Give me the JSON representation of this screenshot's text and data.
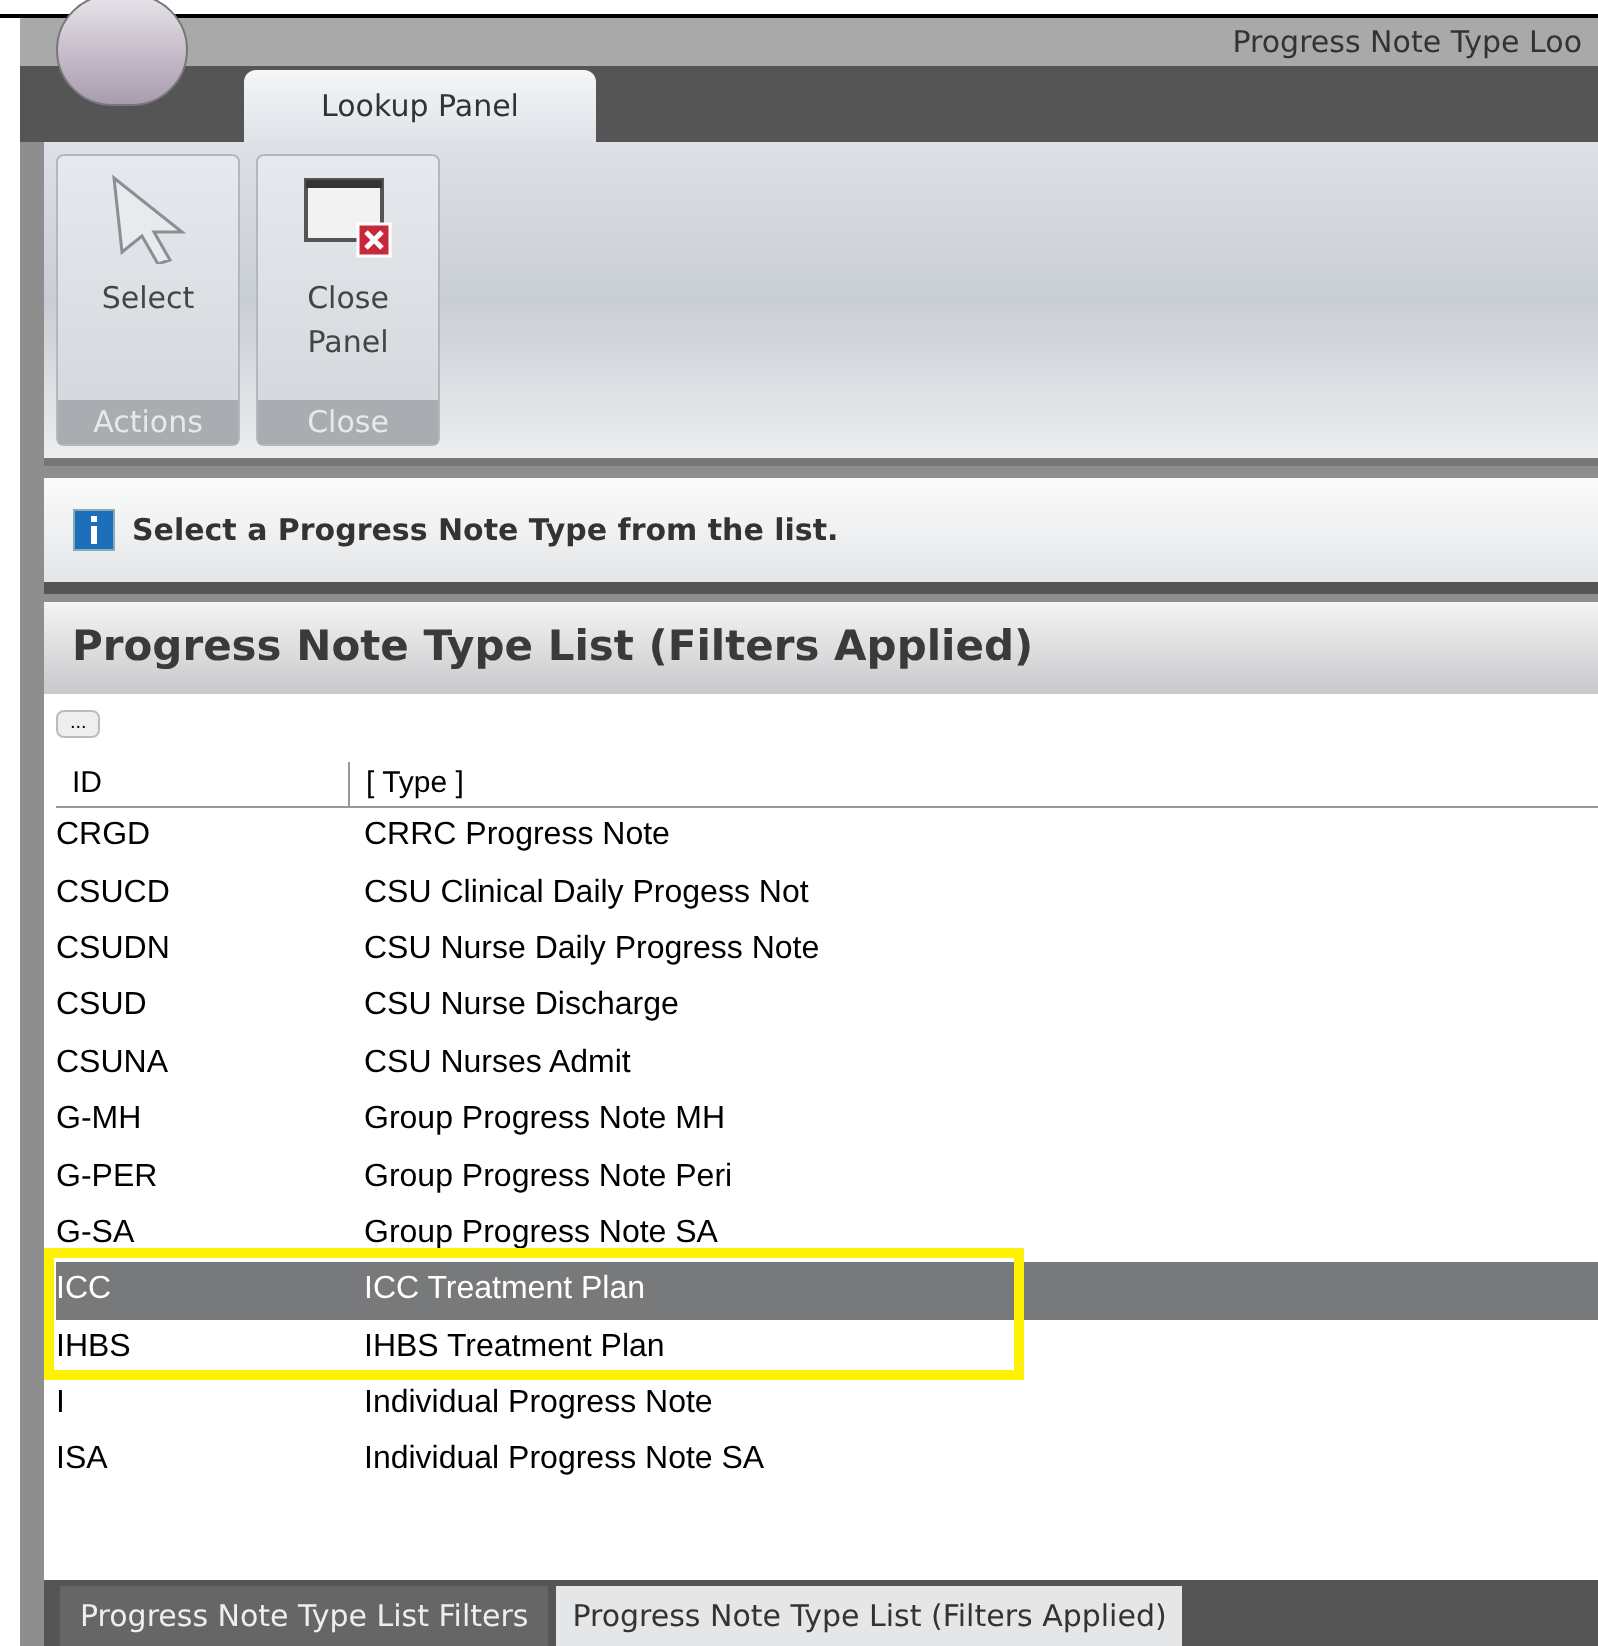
{
  "window": {
    "title": "Progress Note Type Loo"
  },
  "ribbon": {
    "tabs": [
      {
        "label": "Lookup Panel",
        "selected": true
      }
    ],
    "groups": [
      {
        "label": "Actions",
        "buttons": [
          {
            "label": "Select",
            "kind": "pointer"
          }
        ]
      },
      {
        "label": "Close",
        "buttons": [
          {
            "label": "Close Panel",
            "kind": "close"
          }
        ]
      }
    ]
  },
  "info": {
    "message": "Select a Progress Note Type from the list."
  },
  "list": {
    "title": "Progress Note Type List (Filters Applied)",
    "menu_button": "...",
    "columns": [
      "ID",
      "[ Type ]"
    ],
    "rows": [
      {
        "id": "CRGD",
        "type": "CRRC Progress Note",
        "selected": false
      },
      {
        "id": "CSUCD",
        "type": "CSU Clinical Daily Progess Not",
        "selected": false
      },
      {
        "id": "CSUDN",
        "type": "CSU Nurse Daily Progress Note",
        "selected": false
      },
      {
        "id": "CSUD",
        "type": "CSU Nurse Discharge",
        "selected": false
      },
      {
        "id": "CSUNA",
        "type": "CSU Nurses Admit",
        "selected": false
      },
      {
        "id": "G-MH",
        "type": "Group Progress Note MH",
        "selected": false
      },
      {
        "id": "G-PER",
        "type": "Group Progress Note Peri",
        "selected": false
      },
      {
        "id": "G-SA",
        "type": "Group Progress Note SA",
        "selected": false
      },
      {
        "id": "ICC",
        "type": "ICC Treatment Plan",
        "selected": true,
        "highlighted": true
      },
      {
        "id": "IHBS",
        "type": "IHBS Treatment Plan",
        "selected": false,
        "highlighted": true
      },
      {
        "id": "I",
        "type": "Individual Progress Note",
        "selected": false
      },
      {
        "id": "ISA",
        "type": "Individual Progress Note SA",
        "selected": false
      }
    ]
  },
  "bottom_tabs": [
    {
      "label": "Progress Note Type List Filters",
      "selected": false
    },
    {
      "label": "Progress Note Type List (Filters Applied)",
      "selected": true
    }
  ]
}
